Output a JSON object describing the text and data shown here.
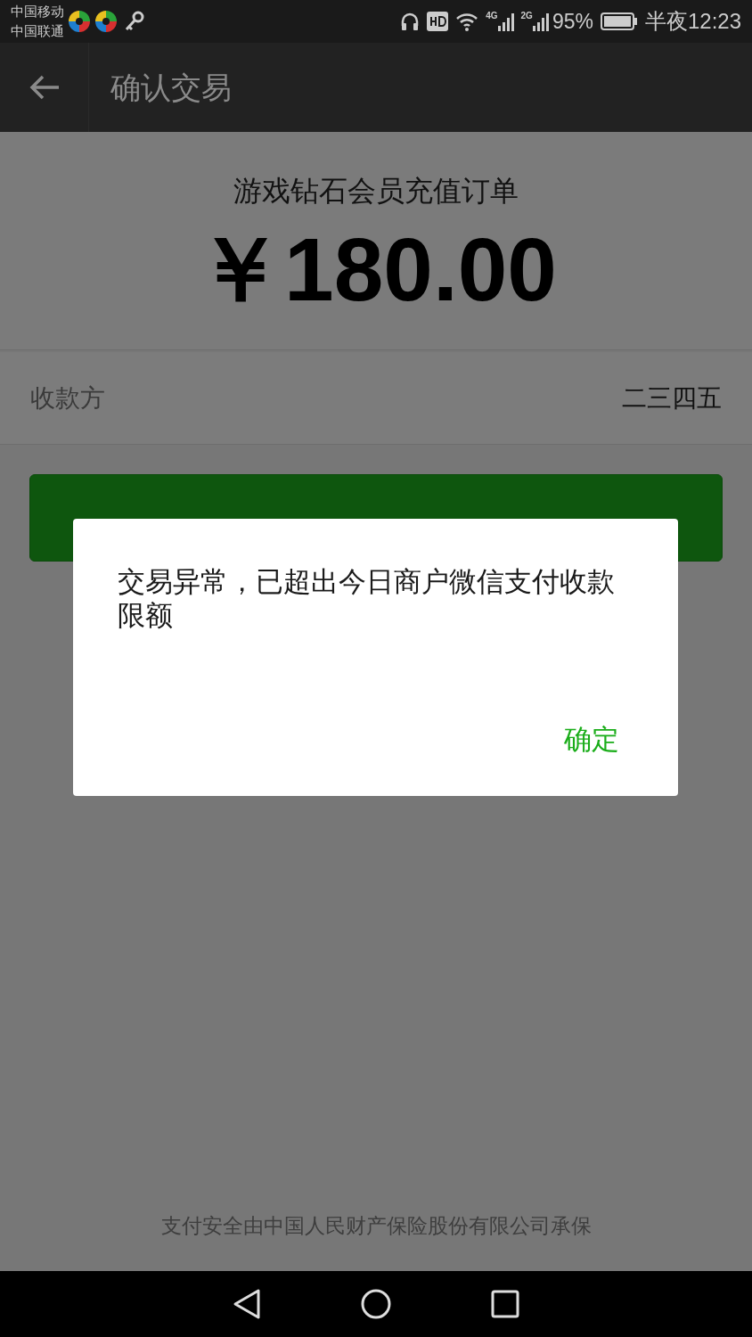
{
  "status_bar": {
    "carriers": [
      "中国移动",
      "中国联通"
    ],
    "net_1": "4G",
    "net_2": "2G",
    "battery": "95%",
    "time": "半夜12:23"
  },
  "nav": {
    "title": "确认交易"
  },
  "order": {
    "title": "游戏钻石会员充值订单",
    "amount": "￥180.00"
  },
  "payee": {
    "label": "收款方",
    "value": "二三四五"
  },
  "pay_button": {
    "disabled": false
  },
  "dialog": {
    "message": "交易异常，已超出今日商户微信支付收款限额",
    "confirm": "确定"
  },
  "footer": "支付安全由中国人民财产保险股份有限公司承保"
}
